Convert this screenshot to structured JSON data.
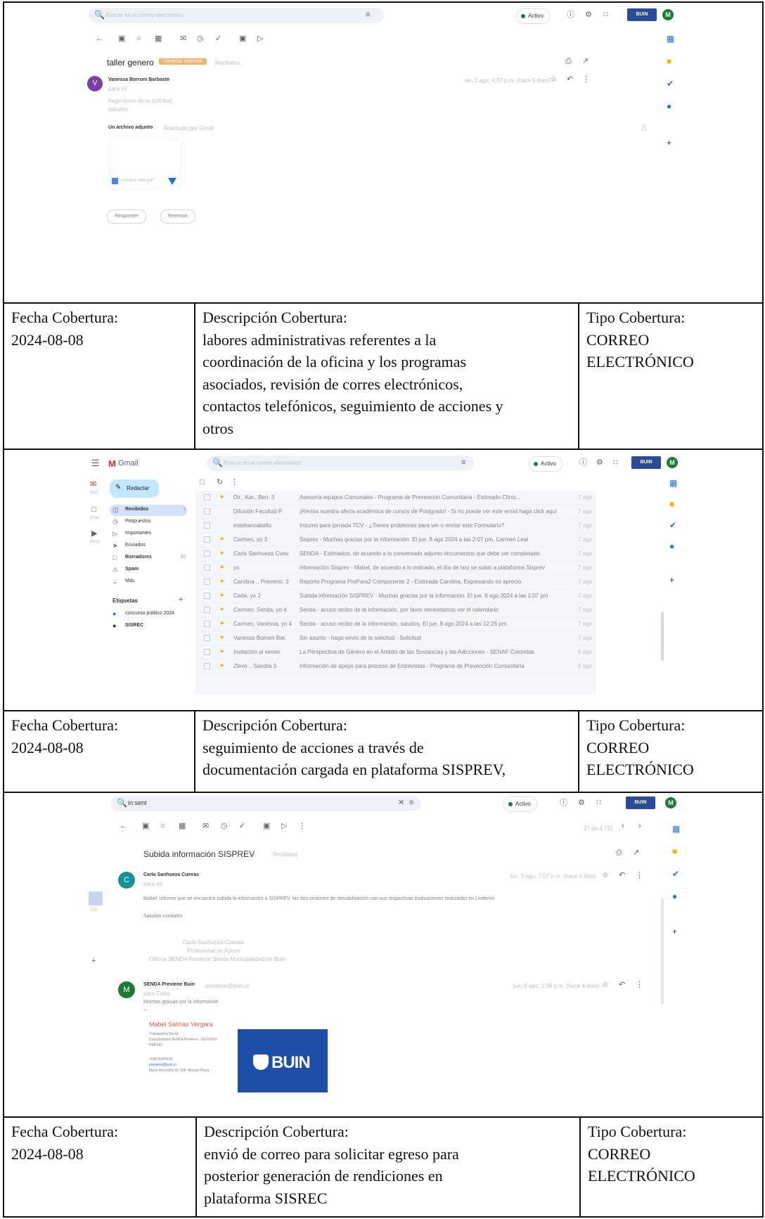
{
  "entries": [
    {
      "fecha_label": "Fecha Cobertura:",
      "fecha": "2024-08-08",
      "desc_label": "Descripción Cobertura:",
      "desc_lines": [
        "labores administrativas referentes a la",
        "coordinación de la oficina y los programas",
        "asociados, revisión de corres electrónicos,",
        "contactos telefónicos, seguimiento de acciones y",
        "otros"
      ],
      "tipo_label": "Tipo Cobertura:",
      "tipo_lines": [
        "CORREO",
        "ELECTRÓNICO"
      ]
    },
    {
      "fecha_label": "Fecha Cobertura:",
      "fecha": "2024-08-08",
      "desc_label": "Descripción Cobertura:",
      "desc_lines": [
        "seguimiento de acciones a través de",
        "documentación cargada en plataforma SISPREV,"
      ],
      "tipo_label": "Tipo Cobertura:",
      "tipo_lines": [
        "CORREO",
        "ELECTRÓNICO"
      ]
    },
    {
      "fecha_label": "Fecha Cobertura:",
      "fecha": "2024-08-08",
      "desc_label": "Descripción Cobertura:",
      "desc_lines": [
        "envió de correo para solicitar egreso para",
        "posterior generación de rendiciones en",
        "plataforma SISREC"
      ],
      "tipo_label": "Tipo Cobertura:",
      "tipo_lines": [
        "CORREO",
        "ELECTRÓNICO"
      ]
    }
  ],
  "shot1": {
    "search_placeholder": "Buscar en el correo electrónico",
    "status": "Activo",
    "brand": "BUIN",
    "avatar": "M",
    "subject": "taller genero",
    "label_tag": "Usuarios externos",
    "inbox_tag": "Recibidos",
    "sender_avatar": "V",
    "sender": "Vanessa Borroni Barbaste",
    "to": "para mí",
    "body_1": "hago envío de la solicitud",
    "body_2": "saludos",
    "attach_title": "Un archivo adjunto",
    "attach_scan": "Analizado por Gmail",
    "file_name": "Solicitud taller.pdf",
    "reply": "Responder",
    "forward": "Reenviar",
    "date": "vie, 2 ago, 4:37 p.m. (hace 5 días)"
  },
  "shot2": {
    "app": "Gmail",
    "search_placeholder": "Buscar en el correo electrónico",
    "status": "Activo",
    "brand": "BUIN",
    "avatar": "M",
    "compose": "Redactar",
    "nav": [
      {
        "label": "Recibidos",
        "count": "1"
      },
      {
        "label": "Pospuestos",
        "count": ""
      },
      {
        "label": "Importantes",
        "count": ""
      },
      {
        "label": "Enviados",
        "count": ""
      },
      {
        "label": "Borradores",
        "count": "10"
      },
      {
        "label": "Spam",
        "count": ""
      },
      {
        "label": "Más",
        "count": ""
      }
    ],
    "labels_title": "Etiquetas",
    "labels": [
      {
        "label": "concurso público 2024",
        "count": ""
      },
      {
        "label": "SISREC",
        "count": ""
      }
    ],
    "rail": [
      "Mail",
      "Chat",
      "Meet"
    ],
    "rows": [
      {
        "sender": "Dir., Kar., Ben. 3",
        "subject": "Asesoría equipos Comunales - Programa de Prevención Comunitaria - Estimado Clínic...",
        "date": "7 ago"
      },
      {
        "sender": "Difusión Facultad P.",
        "subject": "¡Revisa nuestra oferta académica de cursos de Postgrado! - Si no puede ver este email haga click aquí",
        "date": "7 ago"
      },
      {
        "sender": "estebancaballo",
        "subject": "Insumo para jornada TCV - ¿Tienes problemas para ver o enviar este Formulario?",
        "date": "7 ago"
      },
      {
        "sender": "Carmen, yo 3",
        "subject": "Sisprev - Muchas gracias por la información. El jue, 8 ago 2024 a las 2:07 pm, Carmen Leal",
        "date": "7 ago"
      },
      {
        "sender": "Carla Sanhueza Cuev.",
        "subject": "SENDA - Estimados, de acuerdo a lo conversado adjunto documentos que debe ser completado",
        "date": "7 ago"
      },
      {
        "sender": "yo",
        "subject": "Información Sisprev - Mabel, de acuerdo a lo indicado, el día de hoy se subió a plataforma Sisprev",
        "date": "7 ago"
      },
      {
        "sender": "Carolina ., Prevenci. 3",
        "subject": "Reporte Programa PrePara2 Componente 2 - Estimada Carolina, Expresando mi aprecio",
        "date": "7 ago"
      },
      {
        "sender": "Carla, yo 2",
        "subject": "Subida información SISPREV - Muchas gracias por la información. El jue, 8 ago 2024 a las 1:07 pm",
        "date": "7 ago"
      },
      {
        "sender": "Carmen, Senda, yo 4",
        "subject": "Senda - acuso recibo de la información, por favor necesitamos ver el calendario",
        "date": "7 ago"
      },
      {
        "sender": "Carmen, Vanessa, yo 4",
        "subject": "Senda - acuso recibo de la información, saludos, El jue, 8 ago 2024 a las 12:26 pm",
        "date": "7 ago"
      },
      {
        "sender": "Vanessa Borroni Bar.",
        "subject": "Sin asunto - hago envío de la solicitud - Solicitud",
        "date": "7 ago"
      },
      {
        "sender": "Invitación al semin.",
        "subject": "La Perspectiva de Género en el Ámbito de las Sustancias y las Adicciones - SENAF Colombia",
        "date": "6 ago"
      },
      {
        "sender": "Zlevo ., Sandra 3",
        "subject": "Información de apoyo para proceso de Entrevistas - Programa de Prevención Comunitaria",
        "date": "6 ago"
      }
    ]
  },
  "shot3": {
    "search_value": "in:sent",
    "status": "Activo",
    "brand": "BUIN",
    "avatar": "M",
    "counter": "27 de 4.731",
    "subject": "Subida información SISPREV",
    "inbox_tag": "Recibidos",
    "m1_avatar": "C",
    "m1_sender": "Carla Sanhueza Cuevas",
    "m1_to": "para mí",
    "m1_date": "lun, 5 ago, 7:07 p.m. (hace 4 días)",
    "m1_body": "Mabel, informo que se encuentra subida la información a SISPREV, las dos sesiones de sensibilización con sus respectivas evaluaciones realizadas en Linderos",
    "m1_greeting": "Saludos cordiales",
    "m1_sig_1": "Carla Sanhueza Cuevas",
    "m1_sig_2": "Profesional de Apoyo",
    "m1_sig_3": "Oficina SENDA Previene Senda Municipalidad de Buin",
    "m2_avatar": "M",
    "m2_sender": "SENDA Previene Buin",
    "m2_email": "previene@buin.cl",
    "m2_to": "para Carla",
    "m2_date": "jue, 8 ago, 1:06 p.m. (hace 4 días)",
    "m2_body": "Muchas gracias por la información",
    "m2_dash": "--",
    "sig_name": "Mabel Salinas Vergara",
    "sig_role": "Trabajadora Social",
    "sig_office": "Coordinadora SENDA Previene - ESTUDIO",
    "sig_org": "PREVIO",
    "sig_phone": "+56975444103",
    "sig_mail": "previene@buin.cl",
    "sig_addr": "Mario Recordón N° 108, Manuel Plaza",
    "banner_text": "BUIN"
  }
}
